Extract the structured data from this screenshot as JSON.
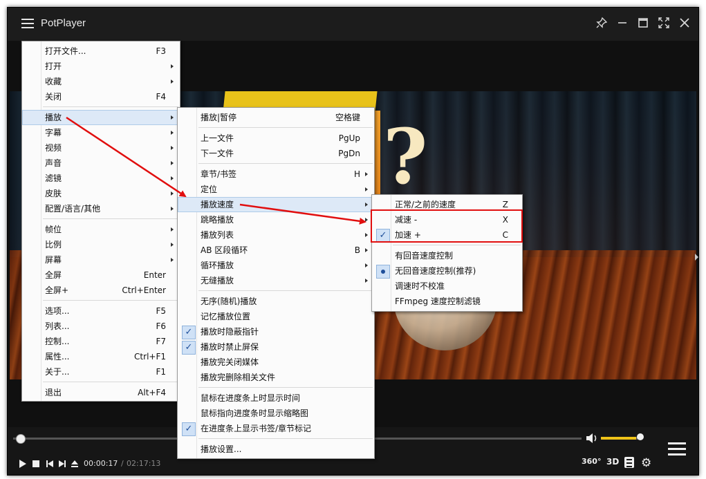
{
  "app": {
    "title": "PotPlayer"
  },
  "playback": {
    "current_time": "00:00:17",
    "separator": "/",
    "total_time": "02:17:13",
    "progress_fraction": 0.002,
    "volume_fraction": 0.85
  },
  "controls": {
    "btn_360": "360°",
    "btn_3d": "3D"
  },
  "main_menu": {
    "items": [
      {
        "label": "打开文件...",
        "shortcut": "F3"
      },
      {
        "label": "打开",
        "submenu": true
      },
      {
        "label": "收藏",
        "submenu": true
      },
      {
        "label": "关闭",
        "shortcut": "F4"
      },
      {
        "label": "播放",
        "submenu": true
      },
      {
        "label": "字幕",
        "submenu": true
      },
      {
        "label": "视频",
        "submenu": true
      },
      {
        "label": "声音",
        "submenu": true
      },
      {
        "label": "滤镜",
        "submenu": true
      },
      {
        "label": "皮肤",
        "submenu": true
      },
      {
        "label": "配置/语言/其他",
        "submenu": true
      },
      {
        "label": "帧位",
        "submenu": true
      },
      {
        "label": "比例",
        "submenu": true
      },
      {
        "label": "屏幕",
        "submenu": true
      },
      {
        "label": "全屏",
        "shortcut": "Enter"
      },
      {
        "label": "全屏+",
        "shortcut": "Ctrl+Enter"
      },
      {
        "label": "选项...",
        "shortcut": "F5"
      },
      {
        "label": "列表...",
        "shortcut": "F6"
      },
      {
        "label": "控制...",
        "shortcut": "F7"
      },
      {
        "label": "属性...",
        "shortcut": "Ctrl+F1"
      },
      {
        "label": "关于...",
        "shortcut": "F1"
      },
      {
        "label": "退出",
        "shortcut": "Alt+F4"
      }
    ]
  },
  "play_menu": {
    "items": [
      {
        "label": "播放|暂停",
        "shortcut": "空格键"
      },
      {
        "label": "上一文件",
        "shortcut": "PgUp"
      },
      {
        "label": "下一文件",
        "shortcut": "PgDn"
      },
      {
        "label": "章节/书签",
        "shortcut": "H"
      },
      {
        "label": "定位"
      },
      {
        "label": "播放速度"
      },
      {
        "label": "跳略播放"
      },
      {
        "label": "播放列表"
      },
      {
        "label": "AB 区段循环",
        "shortcut": "B"
      },
      {
        "label": "循环播放"
      },
      {
        "label": "无缝播放"
      },
      {
        "label": "无序(随机)播放"
      },
      {
        "label": "记忆播放位置"
      },
      {
        "label": "播放时隐蔽指针",
        "checked": true
      },
      {
        "label": "播放时禁止屏保",
        "checked": true
      },
      {
        "label": "播放完关闭媒体"
      },
      {
        "label": "播放完删除相关文件"
      },
      {
        "label": "鼠标在进度条上时显示时间"
      },
      {
        "label": "鼠标指向进度条时显示缩略图"
      },
      {
        "label": "在进度条上显示书签/章节标记",
        "checked": true
      },
      {
        "label": "播放设置..."
      }
    ]
  },
  "speed_menu": {
    "items": [
      {
        "label": "正常/之前的速度",
        "shortcut": "Z"
      },
      {
        "label": "减速 -",
        "shortcut": "X"
      },
      {
        "label": "加速 +",
        "shortcut": "C",
        "checked": true
      },
      {
        "label": "有回音速度控制"
      },
      {
        "label": "无回音速度控制(推荐)",
        "selected": true
      },
      {
        "label": "调速时不校准"
      },
      {
        "label": "FFmpeg 速度控制滤镜"
      }
    ]
  },
  "check_mark": "✓",
  "colors": {
    "highlight_box": "#e10e0e",
    "arrow": "#e10e0e",
    "volume": "#f0c419"
  }
}
